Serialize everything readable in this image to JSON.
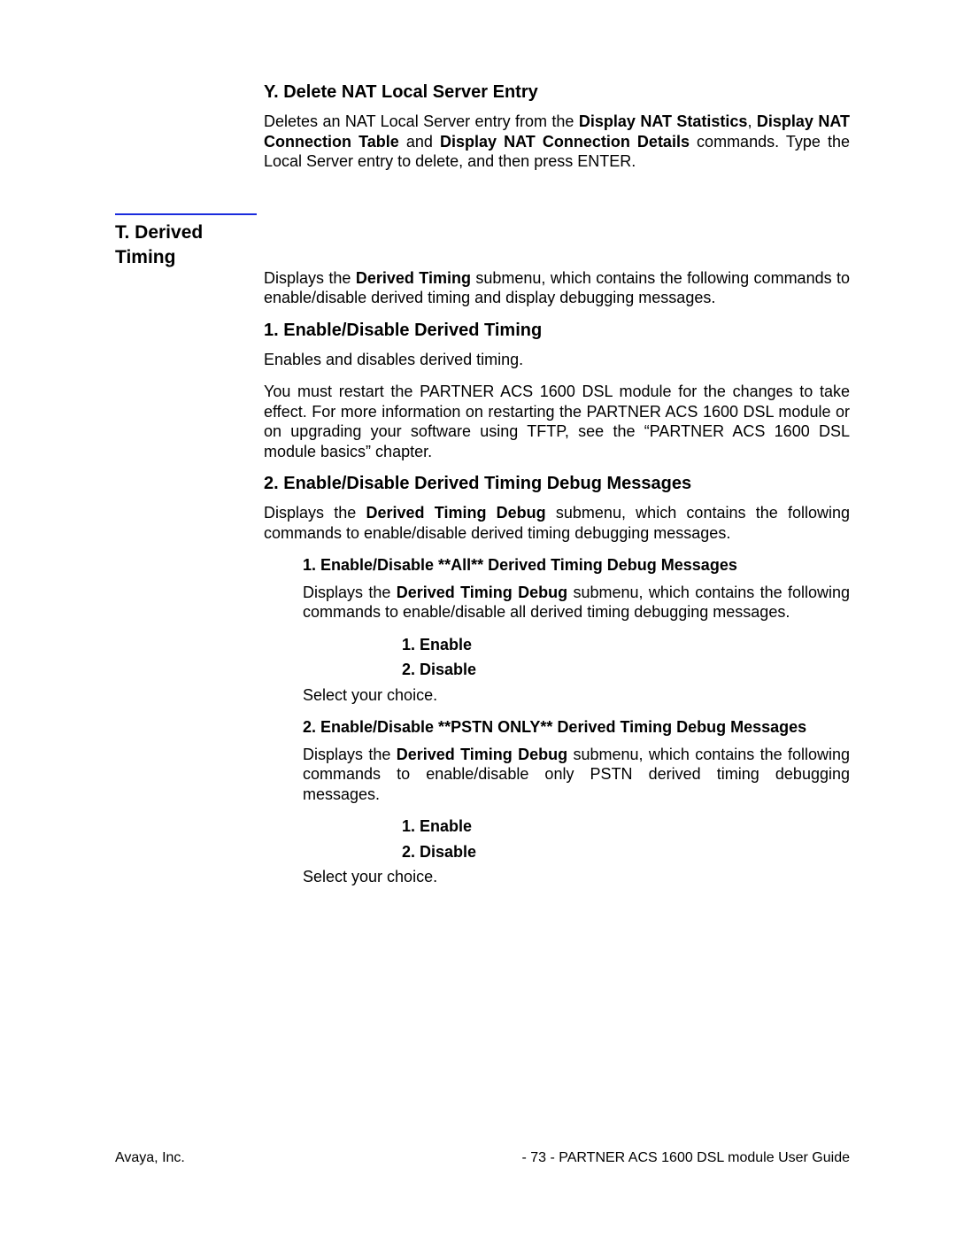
{
  "section_y": {
    "heading": "Y. Delete NAT Local Server Entry",
    "p1a": "Deletes an NAT Local Server entry from the ",
    "b1": "Display NAT Statistics",
    "p1b": ", ",
    "b2": "Display NAT Connection Table",
    "p1c": " and ",
    "b3": "Display NAT Connection Details",
    "p1d": " commands.  Type the Local Server entry to delete, and then press ENTER."
  },
  "side_t": {
    "line1": "T. Derived",
    "line2": "Timing"
  },
  "section_t_intro": {
    "p1a": "Displays the ",
    "b1": "Derived Timing",
    "p1b": " submenu, which contains the following commands to enable/disable derived timing and display debugging messages."
  },
  "section_t1": {
    "heading": "1. Enable/Disable Derived Timing",
    "p1": "Enables and disables derived timing.",
    "p2": "You must restart the PARTNER ACS 1600 DSL module for the changes to take effect.  For more information on restarting the PARTNER ACS 1600 DSL module or on upgrading your software using TFTP, see the “PARTNER ACS 1600 DSL module basics” chapter."
  },
  "section_t2": {
    "heading": "2. Enable/Disable Derived Timing Debug Messages",
    "p1a": "Displays the ",
    "b1": "Derived Timing Debug",
    "p1b": " submenu, which contains the following commands to enable/disable derived timing debugging messages.",
    "sub1": {
      "heading": "1. Enable/Disable **All** Derived Timing Debug Messages",
      "p1a": "Displays the ",
      "b1": "Derived Timing Debug",
      "p1b": " submenu, which contains the following commands to enable/disable all derived timing debugging messages.",
      "item1": "1. Enable",
      "item2": "2. Disable",
      "choice": "Select your choice."
    },
    "sub2": {
      "heading": "2. Enable/Disable **PSTN ONLY** Derived Timing Debug Messages",
      "p1a": "Displays the ",
      "b1": "Derived Timing Debug",
      "p1b": " submenu, which contains the following commands to enable/disable only PSTN derived timing debugging messages.",
      "item1": "1. Enable",
      "item2": "2. Disable",
      "choice": "Select your choice."
    }
  },
  "footer": {
    "left": "Avaya, Inc.",
    "right": "- 73 -  PARTNER ACS 1600 DSL module User Guide"
  }
}
